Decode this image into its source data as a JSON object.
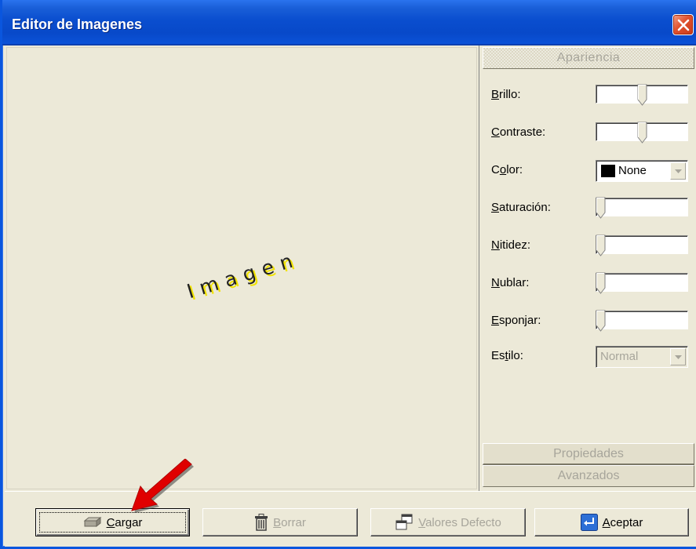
{
  "window": {
    "title": "Editor de Imagenes"
  },
  "preview": {
    "placeholder_text": "Imagen"
  },
  "panel": {
    "tab_apariencia": "Apariencia",
    "tab_propiedades": "Propiedades",
    "tab_avanzados": "Avanzados",
    "brillo_label": "Brillo:",
    "contraste_label": "Contraste:",
    "color_label": "Color:",
    "color_value": "None",
    "saturacion_label": "Saturación:",
    "nitidez_label": "Nitidez:",
    "nublar_label": "Nublar:",
    "esponjar_label": "Esponjar:",
    "estilo_label": "Estilo:",
    "estilo_value": "Normal",
    "brillo_level": 0.5,
    "contraste_level": 0.5,
    "saturacion_level": 0,
    "nitidez_level": 0,
    "nublar_level": 0,
    "esponjar_level": 0
  },
  "buttons": {
    "cargar": "Cargar",
    "borrar": "Borrar",
    "valores": "Valores Defecto",
    "aceptar": "Aceptar"
  },
  "colors": {
    "titlebar": "#0a4ecf",
    "face": "#ece9d8",
    "annotation_arrow": "#e00000",
    "image_text_shadow": "#f1e300"
  },
  "icons": {
    "close": "close-icon",
    "cargar": "load-icon",
    "borrar": "trash-icon",
    "valores": "copy-windows-icon",
    "aceptar": "enter-icon",
    "annotation": "red-arrow-icon"
  }
}
